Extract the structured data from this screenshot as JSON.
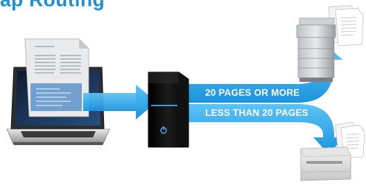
{
  "title": {
    "text": "ap Routing",
    "color": "#1e8fd0"
  },
  "routes": [
    {
      "label": "20 PAGES OR MORE",
      "color": "#2fa9e8",
      "destination": "large-production-printer"
    },
    {
      "label": "LESS THAN 20 PAGES",
      "color": "#2fa9e8",
      "destination": "desktop-laser-printer"
    }
  ],
  "colors": {
    "accent": "#2fa9e8",
    "server_glow": "#3fa9ff"
  },
  "devices": {
    "source": "laptop-icon",
    "document": "document-icon",
    "router": "print-server-icon",
    "large_printer": "copier-icon",
    "small_printer": "printer-icon"
  }
}
